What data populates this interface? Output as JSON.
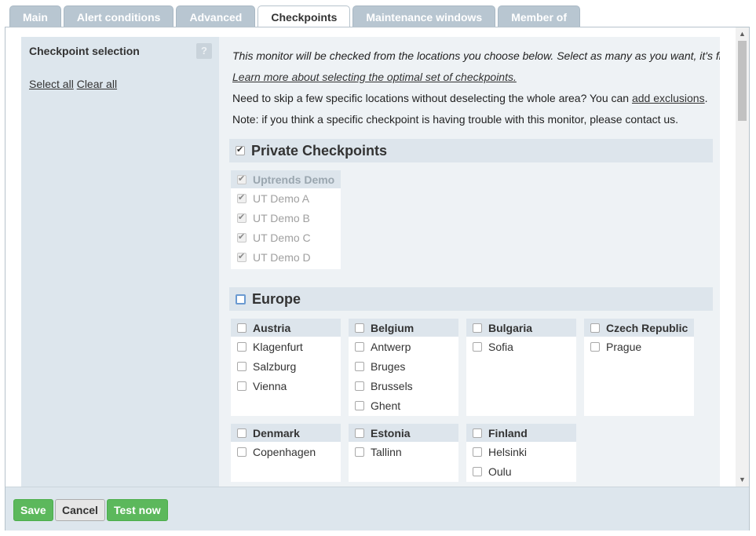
{
  "tabs": [
    {
      "label": "Main"
    },
    {
      "label": "Alert conditions"
    },
    {
      "label": "Advanced"
    },
    {
      "label": "Checkpoints",
      "active": true
    },
    {
      "label": "Maintenance windows"
    },
    {
      "label": "Member of"
    }
  ],
  "sidebar": {
    "title": "Checkpoint selection",
    "help_icon": "question-icon",
    "help_glyph": "?",
    "select_all": "Select all",
    "clear_all": "Clear all"
  },
  "info": {
    "line1": "This monitor will be checked from the locations you choose below. Select as many as you want, it's free!",
    "line2_link": "Learn more about selecting the optimal set of checkpoints.",
    "line3_text": "Need to skip a few specific locations without deselecting the whole area? You can ",
    "line3_link": "add exclusions",
    "line3_end": ".",
    "line4": "Note: if you think a specific checkpoint is having trouble with this monitor, please contact us."
  },
  "private_group": {
    "title": "Private Checkpoints",
    "checked": true,
    "country": {
      "name": "Uptrends Demo",
      "checked": true,
      "disabled": true,
      "cities": [
        {
          "name": "UT Demo A",
          "checked": true
        },
        {
          "name": "UT Demo B",
          "checked": true
        },
        {
          "name": "UT Demo C",
          "checked": true
        },
        {
          "name": "UT Demo D",
          "checked": true
        }
      ]
    }
  },
  "europe_group": {
    "title": "Europe",
    "checked": false,
    "countries": [
      {
        "name": "Austria",
        "cities": [
          "Klagenfurt",
          "Salzburg",
          "Vienna"
        ]
      },
      {
        "name": "Belgium",
        "cities": [
          "Antwerp",
          "Bruges",
          "Brussels",
          "Ghent"
        ]
      },
      {
        "name": "Bulgaria",
        "cities": [
          "Sofia"
        ]
      },
      {
        "name": "Czech Republic",
        "cities": [
          "Prague"
        ]
      },
      {
        "name": "Denmark",
        "cities": [
          "Copenhagen"
        ]
      },
      {
        "name": "Estonia",
        "cities": [
          "Tallinn"
        ]
      },
      {
        "name": "Finland",
        "cities": [
          "Helsinki",
          "Oulu"
        ]
      }
    ]
  },
  "scrollbar": {
    "up_glyph": "▲",
    "down_glyph": "▼"
  },
  "footer": {
    "save": "Save",
    "cancel": "Cancel",
    "test_now": "Test now"
  },
  "colors": {
    "accent_green": "#5cb85c",
    "tab_inactive": "#b8c6d1",
    "panel_bg": "#dde6ed"
  }
}
